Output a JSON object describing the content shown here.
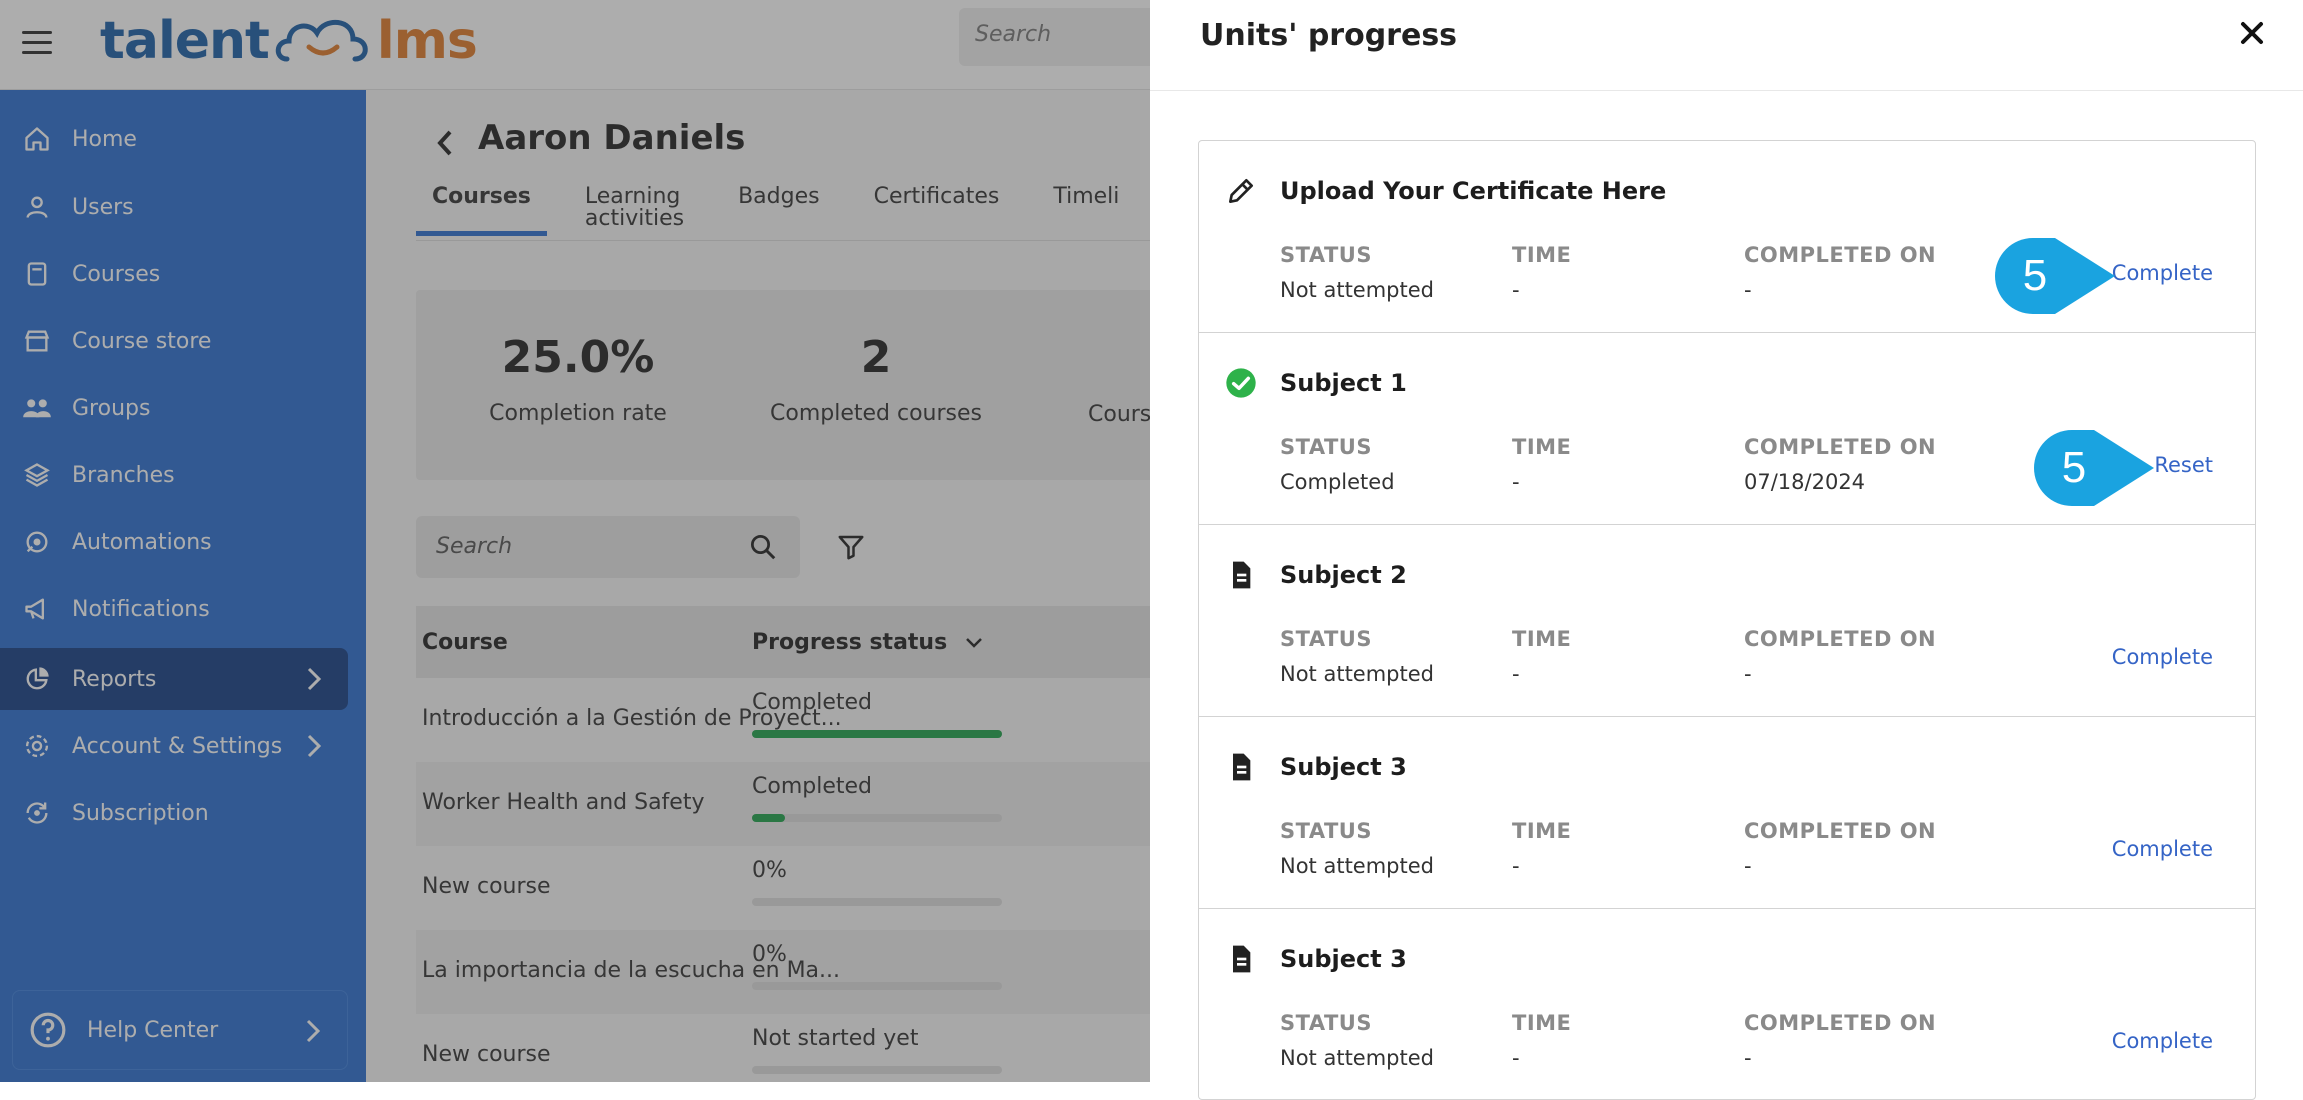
{
  "app": {
    "logo_left": "talent",
    "logo_right": "lms",
    "search_placeholder": "Search"
  },
  "sidebar": {
    "items": [
      {
        "label": "Home",
        "icon": "home-icon"
      },
      {
        "label": "Users",
        "icon": "user-icon"
      },
      {
        "label": "Courses",
        "icon": "book-icon"
      },
      {
        "label": "Course store",
        "icon": "store-icon"
      },
      {
        "label": "Groups",
        "icon": "groups-icon"
      },
      {
        "label": "Branches",
        "icon": "layers-icon"
      },
      {
        "label": "Automations",
        "icon": "automation-icon"
      },
      {
        "label": "Notifications",
        "icon": "megaphone-icon"
      },
      {
        "label": "Reports",
        "icon": "pie-chart-icon",
        "active": true
      },
      {
        "label": "Account & Settings",
        "icon": "gear-icon"
      },
      {
        "label": "Subscription",
        "icon": "subscription-icon"
      }
    ],
    "help": "Help Center",
    "colors": {
      "background": "#2b6fd0",
      "active": "#163f86"
    }
  },
  "main": {
    "user_name": "Aaron Daniels",
    "tabs": [
      "Courses",
      "Learning activities",
      "Badges",
      "Certificates",
      "Timeli"
    ],
    "stats": [
      {
        "value": "25.0%",
        "label": "Completion rate"
      },
      {
        "value": "2",
        "label": "Completed courses"
      },
      {
        "value": "",
        "label": "Course"
      }
    ],
    "search_placeholder": "Search",
    "table": {
      "headers": [
        "Course",
        "Progress status"
      ],
      "rows": [
        {
          "course": "Introducción a la Gestión de Proyect...",
          "status": "Completed",
          "progress": 1.0
        },
        {
          "course": "Worker Health and Safety",
          "status": "Completed",
          "progress": 0.13
        },
        {
          "course": "New course",
          "status": "0%",
          "progress": 0
        },
        {
          "course": "La importancia de la escucha en Ma...",
          "status": "0%",
          "progress": 0
        },
        {
          "course": "New course",
          "status": "Not started yet",
          "progress": 0
        }
      ]
    }
  },
  "panel": {
    "title": "Units' progress",
    "labels": {
      "status": "STATUS",
      "time": "TIME",
      "completed_on": "COMPLETED ON"
    },
    "units": [
      {
        "name": "Upload Your Certificate Here",
        "icon": "pencil-icon",
        "status": "Not attempted",
        "time": "-",
        "completed_on": "-",
        "action": "Complete",
        "callout": "5"
      },
      {
        "name": "Subject 1",
        "icon": "check-circle-icon",
        "status": "Completed",
        "time": "-",
        "completed_on": "07/18/2024",
        "action": "Reset",
        "callout": "5"
      },
      {
        "name": "Subject 2",
        "icon": "document-icon",
        "status": "Not attempted",
        "time": "-",
        "completed_on": "-",
        "action": "Complete"
      },
      {
        "name": "Subject 3",
        "icon": "document-icon",
        "status": "Not attempted",
        "time": "-",
        "completed_on": "-",
        "action": "Complete"
      },
      {
        "name": "Subject 3",
        "icon": "document-icon",
        "status": "Not attempted",
        "time": "-",
        "completed_on": "-",
        "action": "Complete"
      }
    ],
    "colors": {
      "link": "#3564c6",
      "callout": "#1aa3e0",
      "success": "#2eb24a"
    }
  }
}
